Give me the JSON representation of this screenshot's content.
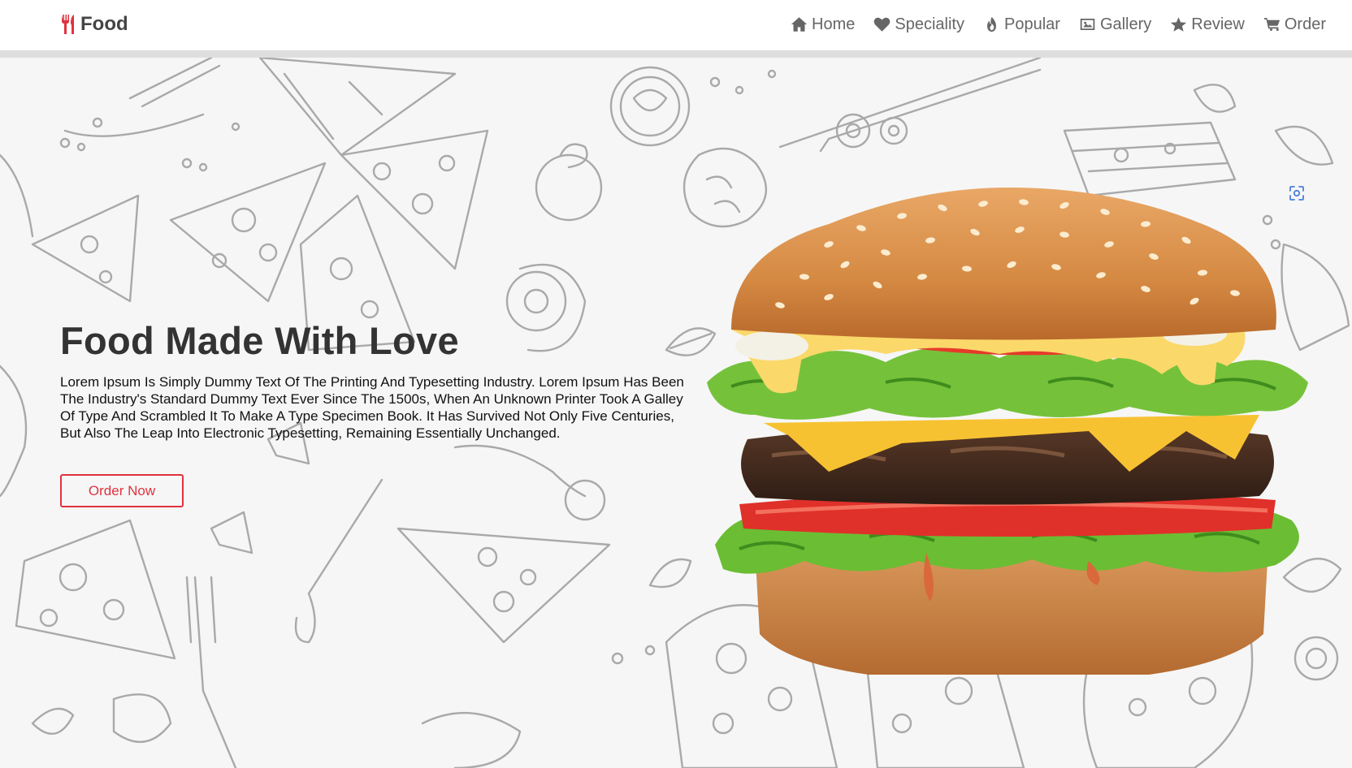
{
  "navbar": {
    "logo_text": "Food",
    "links": [
      {
        "label": "Home",
        "icon": "home-icon"
      },
      {
        "label": "Speciality",
        "icon": "heart-icon"
      },
      {
        "label": "Popular",
        "icon": "fire-icon"
      },
      {
        "label": "Gallery",
        "icon": "image-icon"
      },
      {
        "label": "Review",
        "icon": "star-icon"
      },
      {
        "label": "Order",
        "icon": "cart-icon"
      }
    ]
  },
  "hero": {
    "title": "Food Made With Love",
    "description": "Lorem Ipsum Is Simply Dummy Text Of The Printing And Typesetting Industry. Lorem Ipsum Has Been The Industry's Standard Dummy Text Ever Since The 1500s, When An Unknown Printer Took A Galley Of Type And Scrambled It To Make A Type Specimen Book. It Has Survived Not Only Five Centuries, But Also The Leap Into Electronic Typesetting, Remaining Essentially Unchanged.",
    "button_label": "Order Now"
  },
  "colors": {
    "accent": "#e0333f",
    "nav_text": "#666666",
    "logo_text": "#444444",
    "background": "#f6f6f6"
  }
}
